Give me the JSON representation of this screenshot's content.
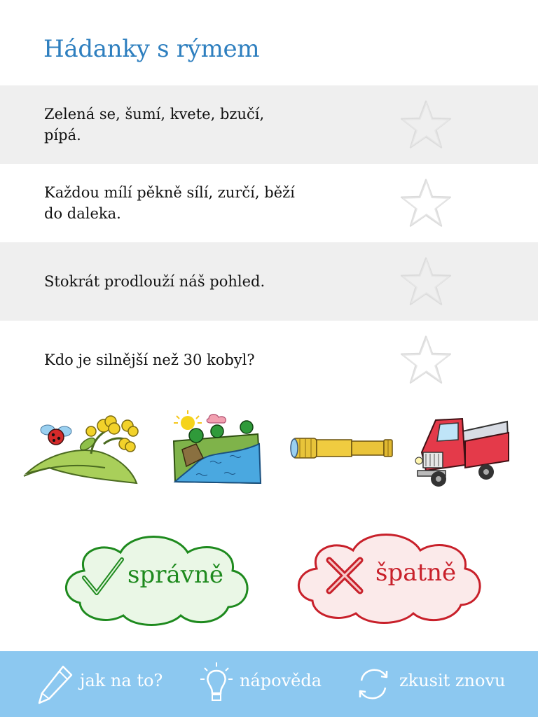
{
  "title": "Hádanky s rýmem",
  "riddles": [
    {
      "text": "Zelená se, šumí, kvete, bzučí, pípá."
    },
    {
      "text": "Každou mílí pěkně sílí, zurčí, běží do daleka."
    },
    {
      "text": "Stokrát prodlouží náš pohled."
    },
    {
      "text": "Kdo je silnější než 30 kobyl?"
    }
  ],
  "pictures": [
    "meadow-ladybug-flower",
    "river-landscape",
    "spyglass",
    "red-truck"
  ],
  "buttons": {
    "correct_label": "správně",
    "wrong_label": "špatně"
  },
  "footer": {
    "howto_label": "jak na to?",
    "hint_label": "nápověda",
    "retry_label": "zkusit znovu"
  },
  "colors": {
    "title": "#2e7fbf",
    "row_shade": "#efefef",
    "correct": "#1e8a1e",
    "wrong": "#c8202a",
    "footer": "#8cc8f0"
  }
}
